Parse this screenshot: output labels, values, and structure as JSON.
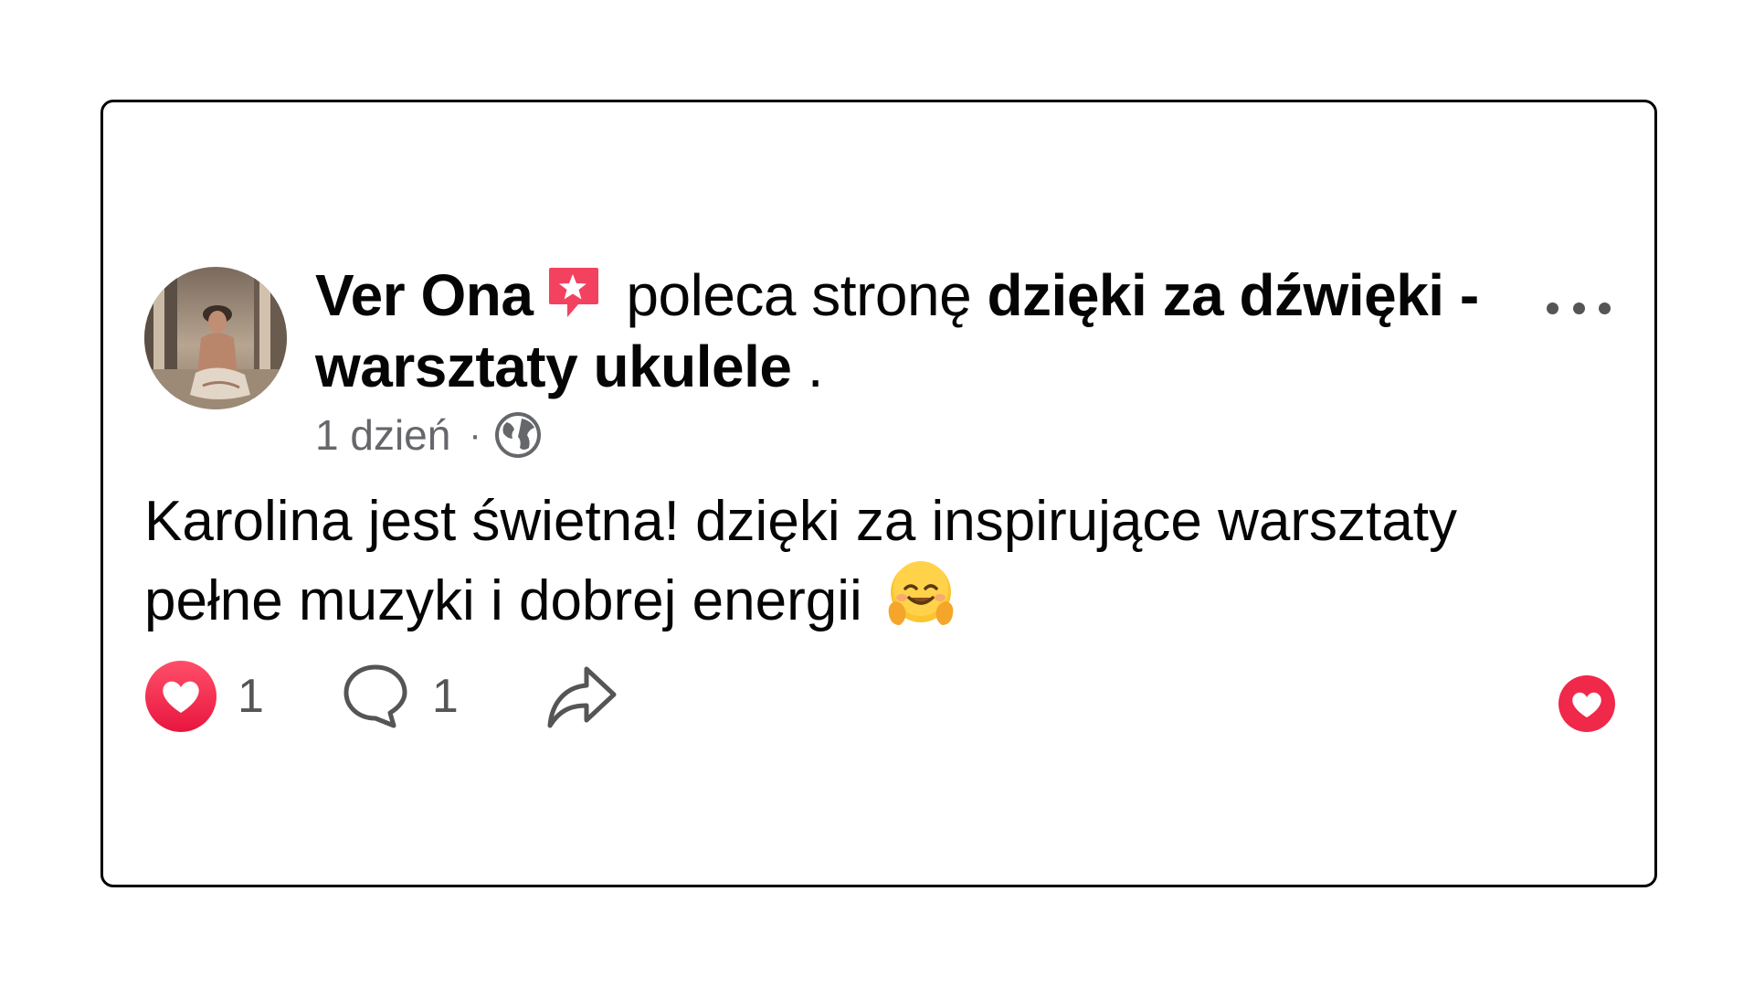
{
  "post": {
    "author": "Ver Ona",
    "action_text": "poleca stronę",
    "page_name": "dzięki za dźwięki - warsztaty ukulele",
    "trailing": ".",
    "time": "1 dzień",
    "separator": "·",
    "privacy_icon": "globe-icon",
    "recommend_icon": "recommendation-badge-icon",
    "text": "Karolina jest świetna! dzięki za inspirujące warsztaty pełne muzyki i dobrej energii",
    "emoji": "hugging-face-emoji"
  },
  "actions": {
    "like_count": "1",
    "comment_count": "1",
    "like_icon": "heart-icon",
    "comment_icon": "comment-bubble-icon",
    "share_icon": "share-arrow-icon",
    "more_icon": "more-options-icon"
  },
  "colors": {
    "heart_red": "#f0284a",
    "badge_red": "#f3425f",
    "text_primary": "#050505",
    "text_secondary": "#65676b"
  }
}
